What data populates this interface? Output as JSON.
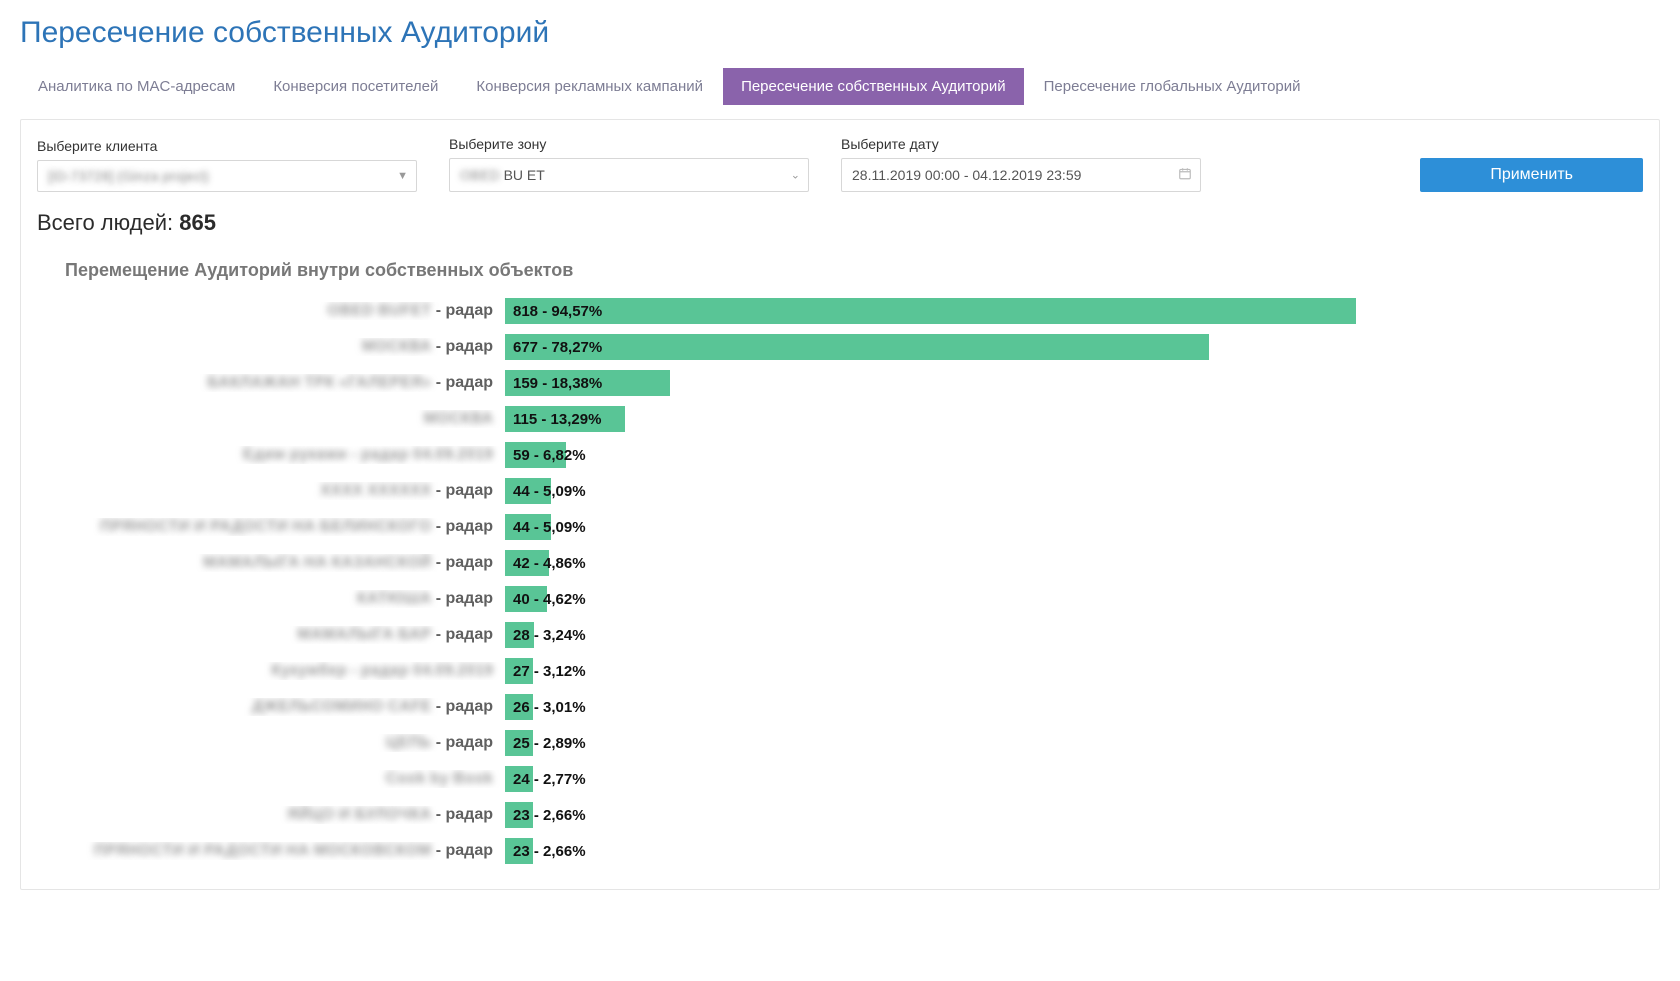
{
  "title": "Пересечение собственных Аудиторий",
  "tabs": [
    {
      "label": "Аналитика по MAC-адресам",
      "active": false
    },
    {
      "label": "Конверсия посетителей",
      "active": false
    },
    {
      "label": "Конверсия рекламных кампаний",
      "active": false
    },
    {
      "label": "Пересечение собственных Аудиторий",
      "active": true
    },
    {
      "label": "Пересечение глобальных Аудиторий",
      "active": false
    }
  ],
  "filters": {
    "client": {
      "label": "Выберите клиента",
      "value_masked": "[ID-73728] (Ginza project)"
    },
    "zone": {
      "label": "Выберите зону",
      "value_prefix_masked": "OBED",
      "value_suffix": " BU   ET"
    },
    "date": {
      "label": "Выберите дату",
      "value": "28.11.2019 00:00 - 04.12.2019 23:59"
    },
    "apply": "Применить"
  },
  "summary": {
    "label": "Всего людей: ",
    "count": "865"
  },
  "chart_title": "Перемещение Аудиторий внутри собственных объектов",
  "bar_color": "#59c596",
  "chart_data": {
    "type": "bar",
    "title": "Перемещение Аудиторий внутри собственных объектов",
    "xlabel": "",
    "ylabel": "",
    "xlim": [
      0,
      100
    ],
    "categories": [
      "OBED BUFET - радар",
      "МОСКВА - радар",
      "БАКЛАЖАН ТРК «ГАЛЕРЕЯ» - радар",
      "МОСКВА",
      "Едим руками - радар 04.09.2019",
      "XXXX XXXXXX - радар",
      "ПРЯНОСТИ И РАДОСТИ НА БЕЛИНСКОГО - радар",
      "МАМАЛЫГА НА КАЗАНСКОЙ - радар",
      "КАТЮША - радар",
      "МАМАЛЫГА БАР - радар",
      "Кукумбер - радар 04.09.2019",
      "ДЖЕЛЬСОМИНО CAFE - радар",
      "ЦЕПЬ - радар",
      "Cook by Book",
      "ЯЙЦО И БУЛОЧКА - радар",
      "ПРЯНОСТИ И РАДОСТИ НА МОСКОВСКОМ - радар"
    ],
    "series": [
      {
        "name": "count",
        "values": [
          818,
          677,
          159,
          115,
          59,
          44,
          44,
          42,
          40,
          28,
          27,
          26,
          25,
          24,
          23,
          23
        ]
      },
      {
        "name": "percent",
        "values": [
          94.57,
          78.27,
          18.38,
          13.29,
          6.82,
          5.09,
          5.09,
          4.86,
          4.62,
          3.24,
          3.12,
          3.01,
          2.89,
          2.77,
          2.66,
          2.66
        ]
      }
    ]
  },
  "rows": [
    {
      "name_masked": "OBED BUFET",
      "suffix": " - радар",
      "count": 818,
      "pct": 94.57,
      "pct_text": "94,57%"
    },
    {
      "name_masked": "МОСКВА",
      "suffix": " - радар",
      "count": 677,
      "pct": 78.27,
      "pct_text": "78,27%"
    },
    {
      "name_masked": "БАКЛАЖАН ТРК «ГАЛЕРЕЯ»",
      "suffix": " - радар",
      "count": 159,
      "pct": 18.38,
      "pct_text": "18,38%"
    },
    {
      "name_masked": "МОСКВА",
      "suffix": "",
      "count": 115,
      "pct": 13.29,
      "pct_text": "13,29%"
    },
    {
      "name_masked": "Едим руками - радар 04.09.2019",
      "suffix": "",
      "count": 59,
      "pct": 6.82,
      "pct_text": "6,82%"
    },
    {
      "name_masked": "XXXX XXXXXX",
      "suffix": " - радар",
      "count": 44,
      "pct": 5.09,
      "pct_text": "5,09%"
    },
    {
      "name_masked": "ПРЯНОСТИ И РАДОСТИ НА БЕЛИНСКОГО",
      "suffix": " - радар",
      "count": 44,
      "pct": 5.09,
      "pct_text": "5,09%"
    },
    {
      "name_masked": "МАМАЛЫГА НА КАЗАНСКОЙ",
      "suffix": " - радар",
      "count": 42,
      "pct": 4.86,
      "pct_text": "4,86%"
    },
    {
      "name_masked": "КАТЮША",
      "suffix": " - радар",
      "count": 40,
      "pct": 4.62,
      "pct_text": "4,62%"
    },
    {
      "name_masked": "МАМАЛЫГА БАР",
      "suffix": " - радар",
      "count": 28,
      "pct": 3.24,
      "pct_text": "3,24%"
    },
    {
      "name_masked": "Кукумбер - радар 04.09.2019",
      "suffix": "",
      "count": 27,
      "pct": 3.12,
      "pct_text": "3,12%"
    },
    {
      "name_masked": "ДЖЕЛЬСОМИНО CAFE",
      "suffix": " - радар",
      "count": 26,
      "pct": 3.01,
      "pct_text": "3,01%"
    },
    {
      "name_masked": "ЦЕПЬ",
      "suffix": " - радар",
      "count": 25,
      "pct": 2.89,
      "pct_text": "2,89%"
    },
    {
      "name_masked": "Cook by Book",
      "suffix": "",
      "count": 24,
      "pct": 2.77,
      "pct_text": "2,77%"
    },
    {
      "name_masked": "ЯЙЦО И БУЛОЧКА",
      "suffix": " - радар",
      "count": 23,
      "pct": 2.66,
      "pct_text": "2,66%"
    },
    {
      "name_masked": "ПРЯНОСТИ И РАДОСТИ НА МОСКОВСКОМ",
      "suffix": " - радар",
      "count": 23,
      "pct": 2.66,
      "pct_text": "2,66%"
    }
  ]
}
